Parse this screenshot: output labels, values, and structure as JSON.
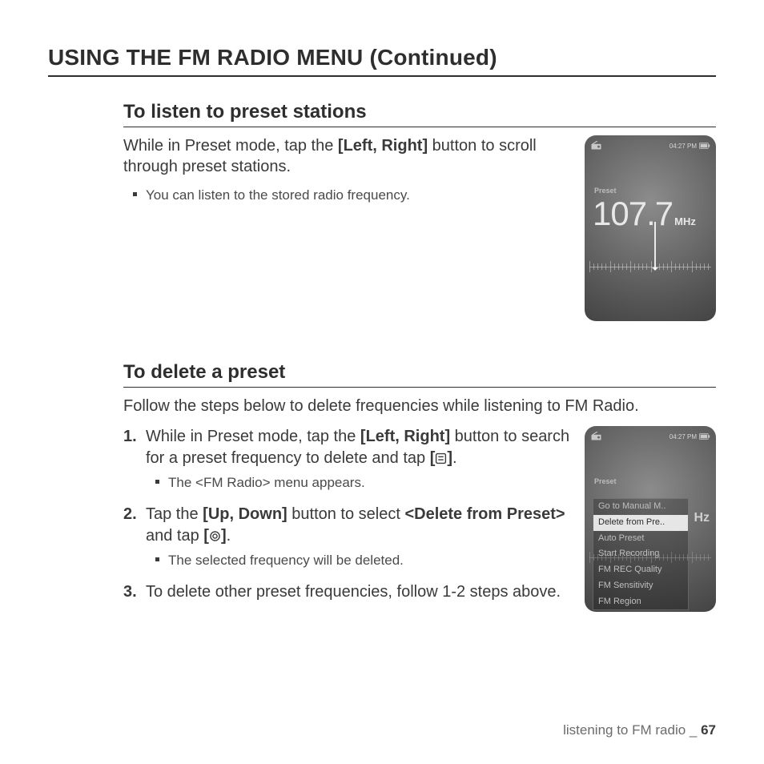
{
  "page_title": "USING THE FM RADIO MENU (Continued)",
  "section1": {
    "title": "To listen to preset stations",
    "para_pre": "While in Preset mode, tap the ",
    "para_btn": "[Left, Right]",
    "para_post": " button to scroll through preset stations.",
    "bullet": "You can listen to the stored radio frequency."
  },
  "section2": {
    "title": "To delete a preset",
    "intro": "Follow the steps below to delete frequencies while listening to FM Radio.",
    "step1_pre": "While in Preset mode, tap the ",
    "step1_btn": "[Left, Right]",
    "step1_mid": " button to search for a preset frequency to delete and tap ",
    "step1_b1": "[",
    "step1_b2": "]",
    "step1_dot": ".",
    "step1_bullet": "The <FM Radio> menu appears.",
    "step2_pre": "Tap the ",
    "step2_btn": "[Up, Down]",
    "step2_mid": " button to select ",
    "step2_sel": "<Delete from Preset>",
    "step2_mid2": " and tap ",
    "step2_b1": "[",
    "step2_b2": "]",
    "step2_dot": ".",
    "step2_bullet": "The selected frequency will be deleted.",
    "step3": "To delete other preset frequencies, follow 1-2 steps above.",
    "n1": "1.",
    "n2": "2.",
    "n3": "3."
  },
  "device": {
    "time": "04:27 PM",
    "preset_label": "Preset",
    "frequency": "107.7",
    "unit": "MHz",
    "menu": [
      "Go to Manual M..",
      "Delete from Pre..",
      "Auto Preset",
      "Start Recording",
      "FM REC Quality",
      "FM Sensitivity",
      "FM Region"
    ],
    "hz_behind": "Hz"
  },
  "footer": {
    "text": "listening to FM radio _ ",
    "page": "67"
  }
}
